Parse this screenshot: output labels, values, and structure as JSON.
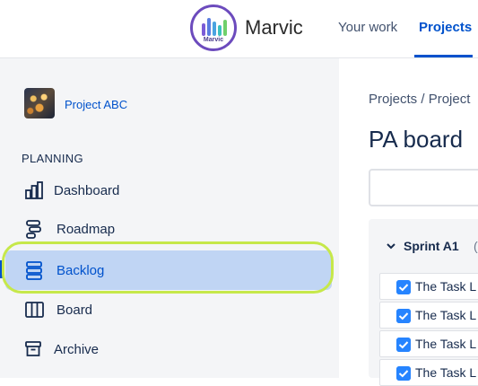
{
  "header": {
    "logo_text": "Marvic",
    "brand": "Marvic",
    "nav": [
      {
        "label": "Your work"
      },
      {
        "label": "Projects"
      }
    ]
  },
  "sidebar": {
    "project_name": "Project ABC",
    "section_title": "PLANNING",
    "items": [
      {
        "label": "Dashboard",
        "icon": "dashboard-icon"
      },
      {
        "label": "Roadmap",
        "icon": "roadmap-icon"
      },
      {
        "label": "Backlog",
        "icon": "backlog-icon",
        "selected": true
      },
      {
        "label": "Board",
        "icon": "board-icon"
      },
      {
        "label": "Archive",
        "icon": "archive-icon"
      }
    ]
  },
  "main": {
    "breadcrumb": [
      "Projects",
      "/",
      "Project"
    ],
    "title": "PA board",
    "sprint": {
      "title": "Sprint A1",
      "paren": "(",
      "tasks": [
        "The Task L",
        "The Task L",
        "The Task L",
        "The Task L"
      ]
    }
  },
  "colors": {
    "accent": "#0052cc",
    "selected_bg": "#c0d5f4",
    "highlight_ring": "#c6e84a",
    "checkbox": "#2684ff"
  }
}
